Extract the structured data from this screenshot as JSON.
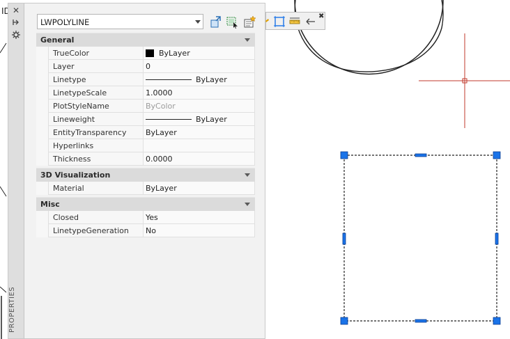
{
  "edge_label": "ID",
  "palette": {
    "title": "PROPERTIES",
    "titlebar_icons": [
      "close-icon",
      "auto-hide-icon",
      "palette-settings-icon"
    ],
    "object_selector": {
      "value": "LWPOLYLINE"
    },
    "toolbar_icons": [
      "toggle-pickadd-icon",
      "select-objects-icon",
      "quick-select-icon"
    ],
    "categories": [
      {
        "name": "General",
        "rows": [
          {
            "name": "TrueColor",
            "value": "ByLayer",
            "swatch": "#000000"
          },
          {
            "name": "Layer",
            "value": "0"
          },
          {
            "name": "Linetype",
            "value": "ByLayer",
            "line": true
          },
          {
            "name": "LinetypeScale",
            "value": "1.0000"
          },
          {
            "name": "PlotStyleName",
            "value": "ByColor",
            "dim": true
          },
          {
            "name": "Lineweight",
            "value": "ByLayer",
            "line": true
          },
          {
            "name": "EntityTransparency",
            "value": "ByLayer"
          },
          {
            "name": "Hyperlinks",
            "value": ""
          },
          {
            "name": "Thickness",
            "value": "0.0000"
          }
        ]
      },
      {
        "name": "3D Visualization",
        "rows": [
          {
            "name": "Material",
            "value": "ByLayer"
          }
        ]
      },
      {
        "name": "Misc",
        "rows": [
          {
            "name": "Closed",
            "value": "Yes"
          },
          {
            "name": "LinetypeGeneration",
            "value": "No"
          }
        ]
      }
    ]
  },
  "floating_toolbar": {
    "icons": [
      "lightbulb-icon",
      "rectangle-icon",
      "measure-icon",
      "undo-icon",
      "close-icon"
    ]
  },
  "colors": {
    "grip": "#1a73e8",
    "crosshair": "#c0392b",
    "geometry": "#222222"
  }
}
